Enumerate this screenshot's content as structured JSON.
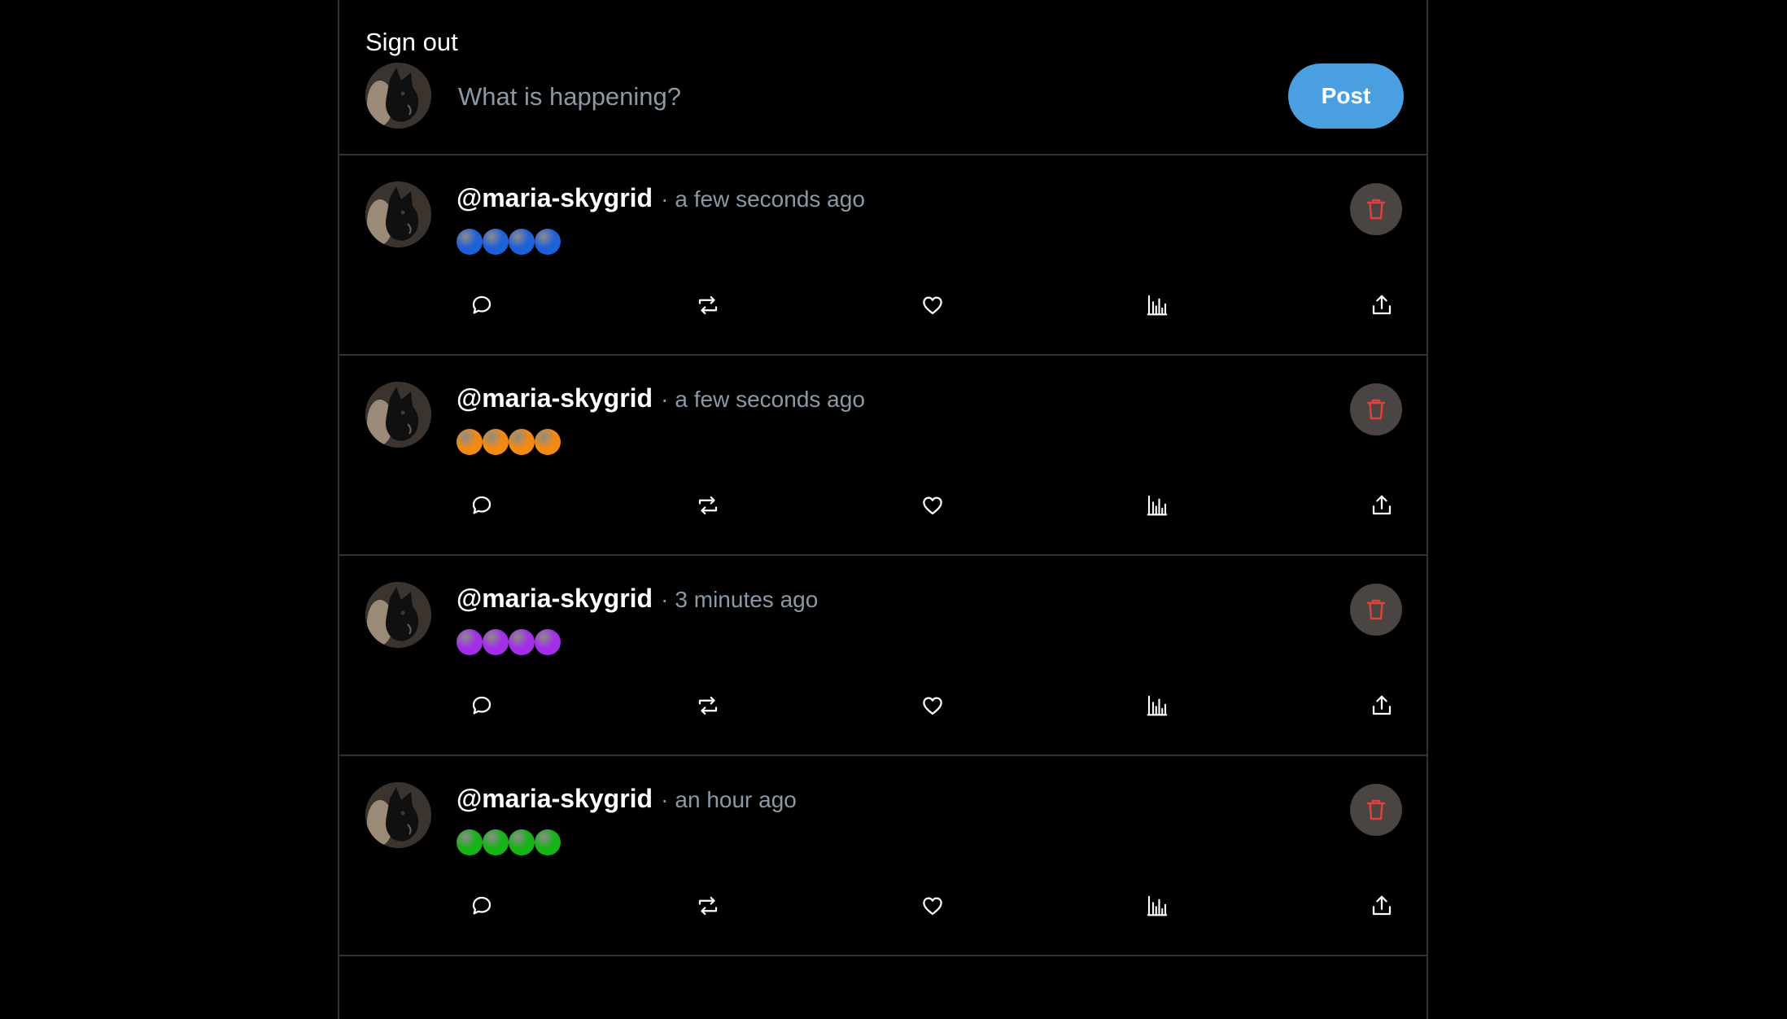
{
  "composer": {
    "sign_out_label": "Sign out",
    "placeholder": "What is happening?",
    "post_button_label": "Post"
  },
  "colors": {
    "post_button": "#4a9fe0",
    "delete_icon": "#e0413a",
    "delete_bg": "#4a4442",
    "muted_text": "#8b98a5",
    "divider": "#2f3336"
  },
  "posts": [
    {
      "handle": "@maria-skygrid",
      "separator": "·",
      "time": "a few seconds ago",
      "content_emoji": "blue-circle x4",
      "dot_color": "#1f5fd8"
    },
    {
      "handle": "@maria-skygrid",
      "separator": "·",
      "time": "a few seconds ago",
      "content_emoji": "orange-circle x4",
      "dot_color": "#f08a12"
    },
    {
      "handle": "@maria-skygrid",
      "separator": "·",
      "time": "3 minutes ago",
      "content_emoji": "purple-circle x4",
      "dot_color": "#a12fe8"
    },
    {
      "handle": "@maria-skygrid",
      "separator": "·",
      "time": "an hour ago",
      "content_emoji": "green-circle x4",
      "dot_color": "#17b317"
    }
  ],
  "icons": {
    "reply": "reply-icon",
    "repost": "repost-icon",
    "like": "heart-icon",
    "views": "analytics-icon",
    "share": "share-icon",
    "delete": "trash-icon"
  }
}
